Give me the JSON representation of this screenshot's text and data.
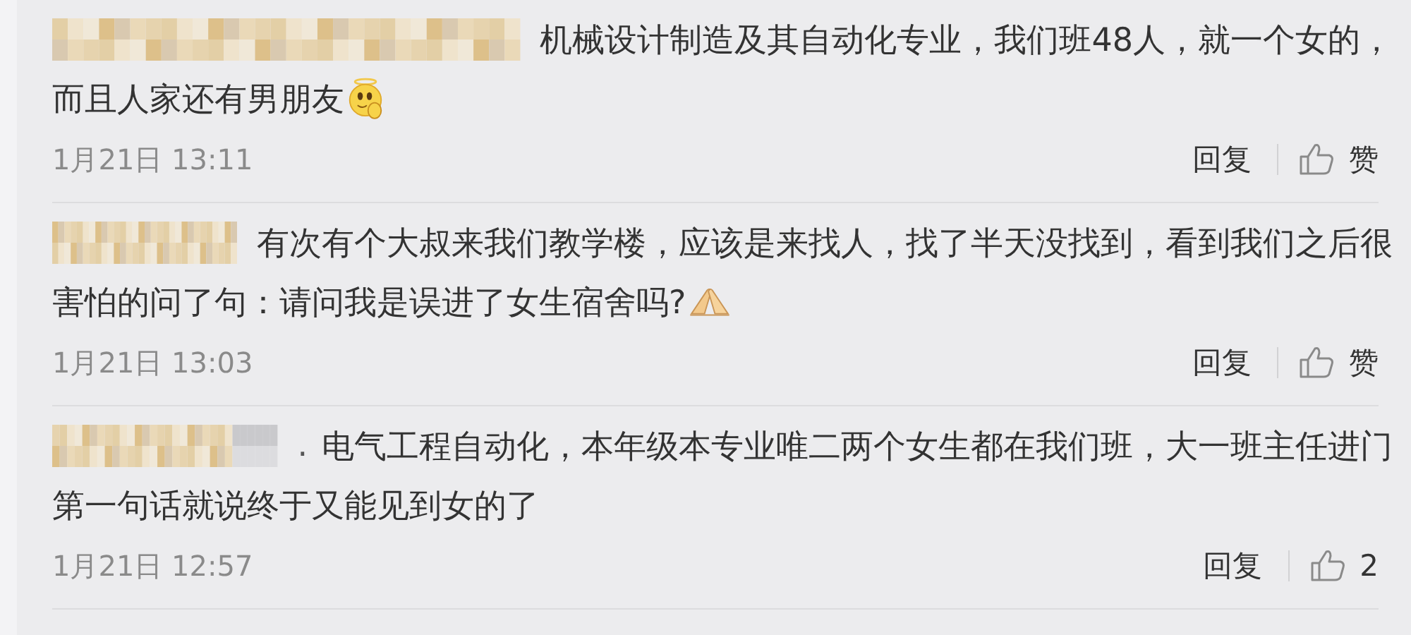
{
  "comments": [
    {
      "author": {
        "kind": "blurred"
      },
      "lines": [
        "机械设计制造及其自动化专业，我们班48人，就一个女的，",
        "而且人家还有男朋友"
      ],
      "emoji": {
        "kind": "halo-face"
      },
      "time": "1月21日 13:11",
      "reply_label": "回复",
      "like": {
        "label": "赞",
        "liked": false
      }
    },
    {
      "author": {
        "kind": "blurred"
      },
      "lines": [
        "有次有个大叔来我们教学楼，应该是来找人，找了半天没找到，看到我们之后很",
        "害怕的问了句：请问我是误进了女生宿舍吗?"
      ],
      "emoji": {
        "kind": "pressed-hands"
      },
      "time": "1月21日 13:03",
      "reply_label": "回复",
      "like": {
        "label": "赞",
        "liked": false
      }
    },
    {
      "author": {
        "kind": "blurred",
        "suffix": "."
      },
      "lines": [
        "电气工程自动化，本年级本专业唯二两个女生都在我们班，大一班主任进门",
        "第一句话就说终于又能见到女的了"
      ],
      "time": "1月21日 12:57",
      "reply_label": "回复",
      "like": {
        "label": "2",
        "liked": false
      }
    }
  ]
}
